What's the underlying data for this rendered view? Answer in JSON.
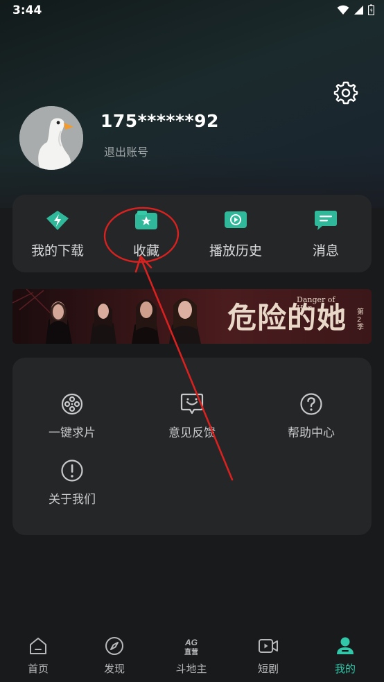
{
  "status_bar": {
    "time": "3:44"
  },
  "profile": {
    "username": "175******92",
    "logout_label": "退出账号"
  },
  "quick_actions": [
    {
      "label": "我的下载",
      "icon": "download-bolt-icon"
    },
    {
      "label": "收藏",
      "icon": "favorites-star-icon"
    },
    {
      "label": "播放历史",
      "icon": "play-history-icon"
    },
    {
      "label": "消息",
      "icon": "message-icon"
    }
  ],
  "banner": {
    "title": "危险的她",
    "subtitle": "Danger of Her",
    "season": "第2季"
  },
  "services": [
    {
      "label": "一键求片",
      "icon": "film-reel-icon"
    },
    {
      "label": "意见反馈",
      "icon": "feedback-icon"
    },
    {
      "label": "帮助中心",
      "icon": "help-icon"
    },
    {
      "label": "关于我们",
      "icon": "about-icon"
    }
  ],
  "tabbar": {
    "items": [
      {
        "label": "首页",
        "icon": "home-icon"
      },
      {
        "label": "发现",
        "icon": "compass-icon"
      },
      {
        "label": "斗地主",
        "icon": "ag-live-icon",
        "icon_text": [
          "AG",
          "直营"
        ]
      },
      {
        "label": "短剧",
        "icon": "video-icon"
      },
      {
        "label": "我的",
        "icon": "profile-icon"
      }
    ],
    "active_index": 4
  },
  "colors": {
    "accent": "#31c7a8",
    "annotation": "#d9211f",
    "card": "#252628",
    "background": "#191a1c"
  }
}
